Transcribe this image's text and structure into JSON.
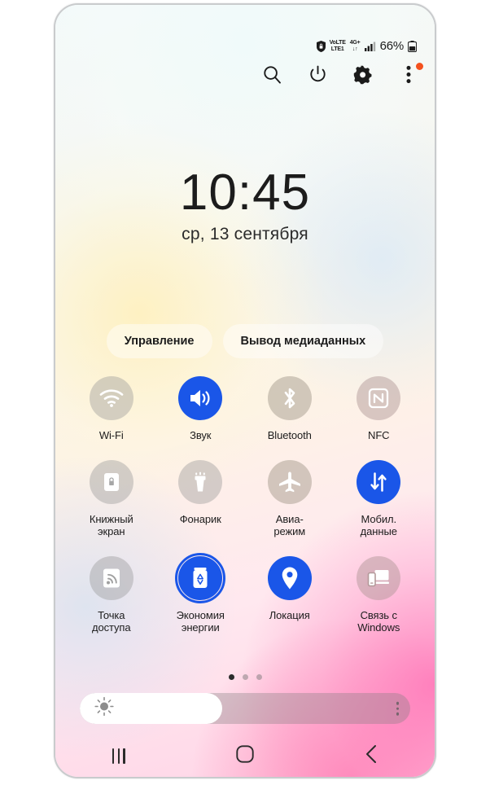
{
  "statusbar": {
    "secure_icon": "lock-shield-icon",
    "volte_top": "VoLTE",
    "volte_bottom": "LTE1",
    "network_top": "4G+",
    "network_bottom": "↓↑",
    "signal_icon": "signal-bars-icon",
    "battery_percent": "66%",
    "battery_icon": "battery-icon"
  },
  "header": {
    "search_icon": "search-icon",
    "power_icon": "power-icon",
    "settings_icon": "gear-icon",
    "more_icon": "more-vertical-icon",
    "badge_color": "#f4511e"
  },
  "clock": {
    "time": "10:45",
    "date": "ср, 13 сентября"
  },
  "pills": [
    {
      "label": "Управление",
      "name": "control-pill"
    },
    {
      "label": "Вывод медиаданных",
      "name": "media-output-pill"
    }
  ],
  "toggles": [
    {
      "label": "Wi-Fi",
      "icon": "wifi-icon",
      "state": "off",
      "style": "off"
    },
    {
      "label": "Звук",
      "icon": "sound-icon",
      "state": "on",
      "style": "on"
    },
    {
      "label": "Bluetooth",
      "icon": "bluetooth-icon",
      "state": "off",
      "style": "off2"
    },
    {
      "label": "NFC",
      "icon": "nfc-icon",
      "state": "off",
      "style": "off3"
    },
    {
      "label": "Книжный\nэкран",
      "icon": "screen-lock-icon",
      "state": "off",
      "style": "off"
    },
    {
      "label": "Фонарик",
      "icon": "flashlight-icon",
      "state": "off",
      "style": "off"
    },
    {
      "label": "Авиа-\nрежим",
      "icon": "airplane-icon",
      "state": "off",
      "style": "off2"
    },
    {
      "label": "Мобил.\nданные",
      "icon": "mobile-data-icon",
      "state": "on",
      "style": "on"
    },
    {
      "label": "Точка\nдоступа",
      "icon": "hotspot-icon",
      "state": "off",
      "style": "off"
    },
    {
      "label": "Экономия\nэнергии",
      "icon": "power-saving-icon",
      "state": "on-ring",
      "style": "on"
    },
    {
      "label": "Локация",
      "icon": "location-pin-icon",
      "state": "on",
      "style": "on"
    },
    {
      "label": "Связь с\nWindows",
      "icon": "link-to-windows-icon",
      "state": "off",
      "style": "off3"
    }
  ],
  "page_indicator": {
    "count": 3,
    "active_index": 0
  },
  "brightness": {
    "name": "brightness-slider",
    "fill_percent": 43,
    "sun_icon": "brightness-sun-icon",
    "menu_icon": "more-vertical-icon"
  },
  "navbar": {
    "recents_icon": "recents-icon",
    "home_icon": "home-icon",
    "back_icon": "back-icon"
  },
  "colors": {
    "accent": "#1a56e8",
    "badge": "#f4511e",
    "text": "#1c1c1c"
  }
}
